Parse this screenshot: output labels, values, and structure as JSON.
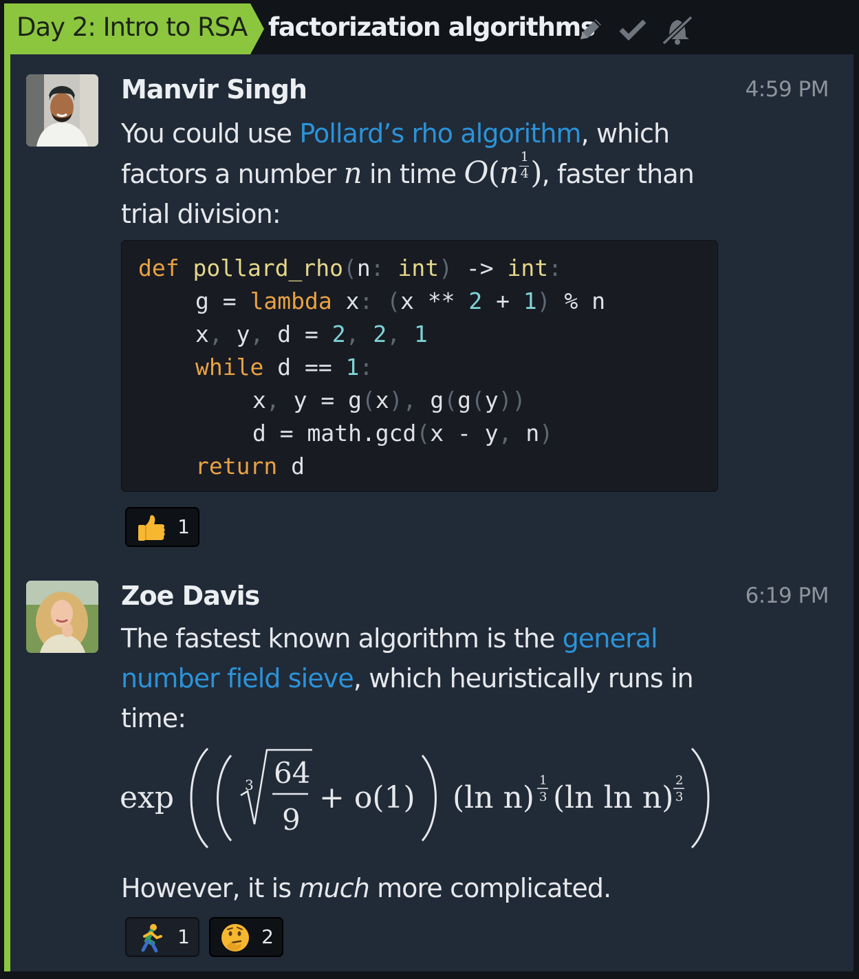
{
  "header": {
    "stream": "Day 2: Intro to RSA",
    "topic": "factorization algorithms",
    "icons": [
      "pencil-icon",
      "check-icon",
      "mute-icon"
    ]
  },
  "messages": [
    {
      "sender": "Manvir Singh",
      "time": "4:59 PM",
      "text_before_link": "You could use ",
      "link": "Pollard’s rho algorithm",
      "text_after_link": ", which factors a number ",
      "var_n": "n",
      "text_in_time": " in time ",
      "big_o": "O",
      "exponent_num": "1",
      "exponent_den": "4",
      "text_end": "), faster than trial division:",
      "code": {
        "line1": {
          "kw": "def",
          "fn": "pollard_rho",
          "p1": "(",
          "arg": "n",
          "colon": ":",
          "type1": "int",
          "p2": ")",
          "arrow": "->",
          "type2": "int",
          "colon2": ":"
        },
        "line2": {
          "a": "g = ",
          "kw": "lambda",
          "b": " x",
          "c": ":",
          "d": " ",
          "p1": "(",
          "e": "x ** ",
          "n1": "2",
          "f": " + ",
          "n2": "1",
          "p2": ")",
          "g": " % n"
        },
        "line3": {
          "a": "x",
          "c1": ",",
          "b": " y",
          "c2": ",",
          "d": " d = ",
          "n1": "2",
          "c3": ",",
          "n2": " 2",
          "c4": ",",
          "n3": " 1"
        },
        "line4": {
          "kw": "while",
          "a": " d == ",
          "n1": "1",
          "c": ":"
        },
        "line5": {
          "a": "x",
          "c1": ",",
          "b": " y = g",
          "p1": "(",
          "x": "x",
          "p2": ")",
          "c2": ",",
          "d": " g",
          "p3": "(",
          "e": "g",
          "p4": "(",
          "y": "y",
          "p5": "))"
        },
        "line6": {
          "a": "d = math.gcd",
          "p1": "(",
          "b": "x - y",
          "c": ",",
          "d": " n",
          "p2": ")"
        },
        "line7": {
          "kw": "return",
          "a": " d"
        }
      },
      "reactions": [
        {
          "emoji": "thumbs-up",
          "count": "1",
          "selected": true
        }
      ]
    },
    {
      "sender": "Zoe Davis",
      "time": "6:19 PM",
      "text_before_link": "The fastest known algorithm is the ",
      "link_part1": "general",
      "link_part2": "number field sieve",
      "text_after_link": ", which heuristically runs in",
      "text_line3": "time:",
      "formula": {
        "exp": "exp",
        "root_index": "3",
        "frac_num": "64",
        "frac_den": "9",
        "plus_term": "+ o(1)",
        "ln_n": "(ln n)",
        "exp1_num": "1",
        "exp1_den": "3",
        "lnln_n": "(ln ln n)",
        "exp2_num": "2",
        "exp2_den": "3"
      },
      "closing_before": "However, it is ",
      "closing_em": "much",
      "closing_after": " more complicated.",
      "reactions": [
        {
          "emoji": "running-person",
          "count": "1",
          "selected": false
        },
        {
          "emoji": "thinking-face",
          "count": "2",
          "selected": true
        }
      ]
    }
  ]
}
